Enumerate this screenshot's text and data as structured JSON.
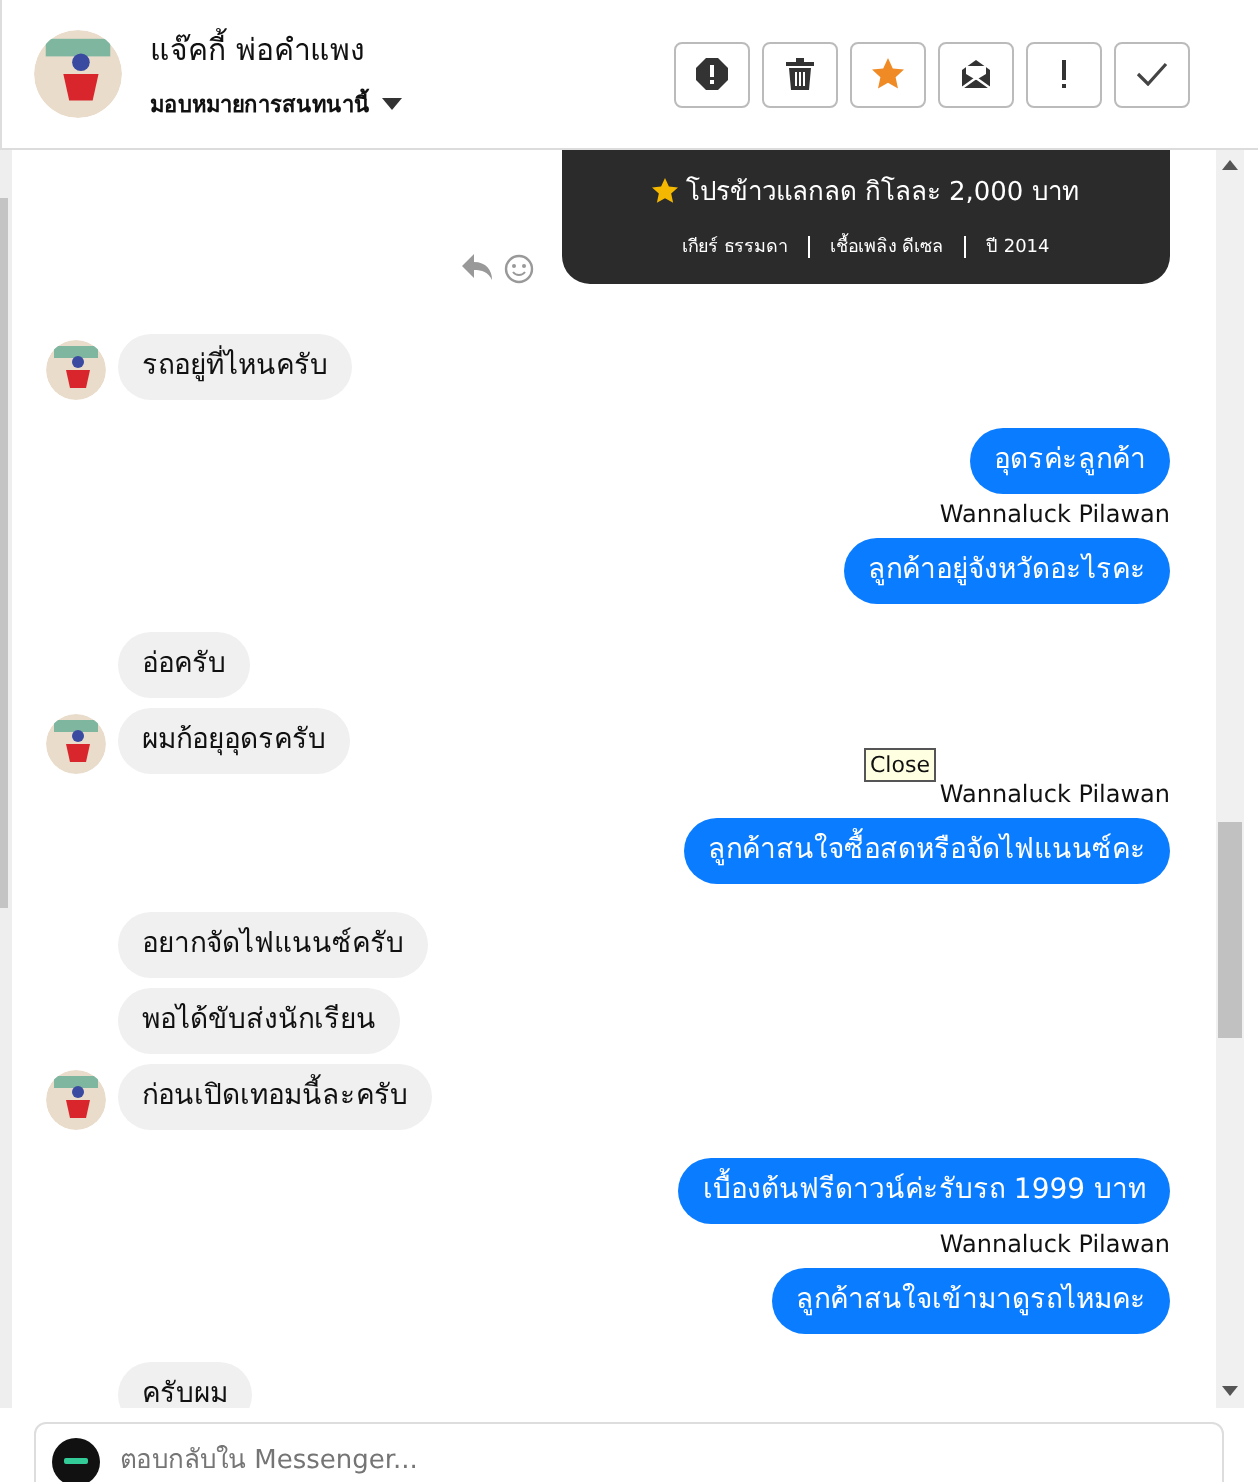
{
  "header": {
    "name": "แจ๊คกี้ พ่อคำแพง",
    "assign": "มอบหมายการสนทนานี้",
    "actions": [
      {
        "kind": "spam"
      },
      {
        "kind": "trash"
      },
      {
        "kind": "star"
      },
      {
        "kind": "unread"
      },
      {
        "kind": "important"
      },
      {
        "kind": "done"
      }
    ]
  },
  "card": {
    "promo": "โปรข้าวแลกลด กิโลละ 2,000 บาท",
    "specs": [
      "เกียร์ ธรรมดา",
      "เชื้อเพลิง ดีเซล",
      "ปี 2014"
    ]
  },
  "messages": [
    {
      "kind": "in",
      "text": "รถอยู่ที่ไหนครับ",
      "avatar": true
    },
    {
      "kind": "out",
      "text": "อุดรค่ะลูกค้า"
    },
    {
      "kind": "sender",
      "text": "Wannaluck Pilawan"
    },
    {
      "kind": "out",
      "text": "ลูกค้าอยู่จังหวัดอะไรคะ"
    },
    {
      "kind": "in",
      "text": "อ่อครับ",
      "avatar": false
    },
    {
      "kind": "in",
      "text": "ผมก้อยุอุดรครับ",
      "avatar": true
    },
    {
      "kind": "sender",
      "text": "Wannaluck Pilawan"
    },
    {
      "kind": "out",
      "text": "ลูกค้าสนใจซื้อสดหรือจัดไฟแนนซ์คะ"
    },
    {
      "kind": "in",
      "text": "อยากจัดไฟแนนซ์ครับ",
      "avatar": false
    },
    {
      "kind": "in",
      "text": "พอได้ขับส่งนักเรียน",
      "avatar": false
    },
    {
      "kind": "in",
      "text": "ก่อนเปิดเทอมนี้ละครับ",
      "avatar": true
    },
    {
      "kind": "out",
      "text": "เบื้องต้นฟรีดาวน์ค่ะรับรถ 1999 บาท"
    },
    {
      "kind": "sender",
      "text": "Wannaluck Pilawan"
    },
    {
      "kind": "out",
      "text": "ลูกค้าสนใจเข้ามาดูรถไหมคะ"
    },
    {
      "kind": "in",
      "text": "ครับผม",
      "avatar": false
    }
  ],
  "tooltip": "Close",
  "composer": {
    "placeholder": "ตอบกลับใน Messenger..."
  }
}
